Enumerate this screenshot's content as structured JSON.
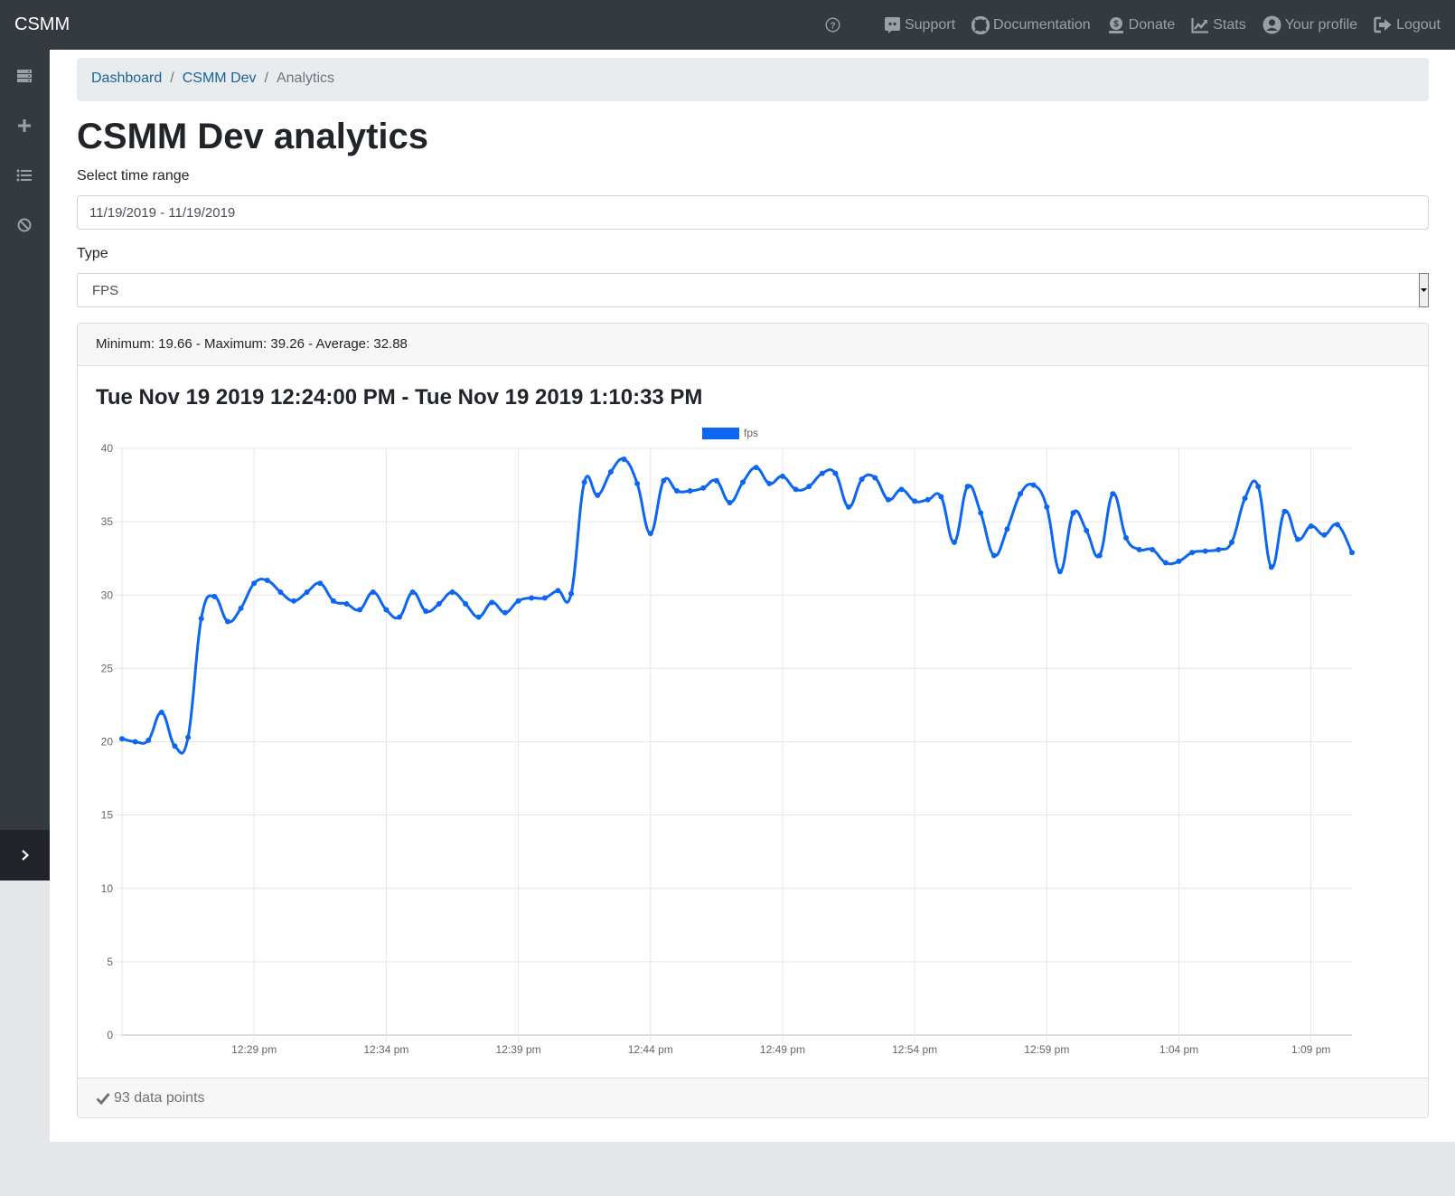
{
  "app": {
    "brand": "CSMM"
  },
  "nav": {
    "support": "Support",
    "documentation": "Documentation",
    "donate": "Donate",
    "stats": "Stats",
    "profile": "Your profile",
    "logout": "Logout"
  },
  "breadcrumb": {
    "dashboard": "Dashboard",
    "server": "CSMM Dev",
    "current": "Analytics"
  },
  "page": {
    "title": "CSMM Dev analytics",
    "time_range_label": "Select time range",
    "time_range_value": "11/19/2019 - 11/19/2019",
    "type_label": "Type",
    "type_value": "FPS"
  },
  "card": {
    "summary": "Minimum: 19.66 - Maximum: 39.26 - Average: 32.88",
    "title": "Tue Nov 19 2019 12:24:00 PM - Tue Nov 19 2019 1:10:33 PM",
    "footer": "93 data points"
  },
  "colors": {
    "line": "#0d66f0",
    "topbar": "#343a40",
    "link": "#1a6496"
  },
  "chart_data": {
    "type": "line",
    "title": "",
    "xlabel": "",
    "ylabel": "",
    "ylim": [
      0,
      40
    ],
    "y_ticks": [
      0,
      5,
      10,
      15,
      20,
      25,
      30,
      35,
      40
    ],
    "x_tick_labels": [
      "12:29 pm",
      "12:34 pm",
      "12:39 pm",
      "12:44 pm",
      "12:49 pm",
      "12:54 pm",
      "12:59 pm",
      "1:04 pm",
      "1:09 pm"
    ],
    "x_tick_minutes": [
      5,
      10,
      15,
      20,
      25,
      30,
      35,
      40,
      45
    ],
    "x_range_minutes": [
      0,
      46.55
    ],
    "grid": true,
    "legend": "top-center",
    "series": [
      {
        "name": "fps",
        "x_minutes": [
          0,
          0.5,
          1,
          1.5,
          2,
          2.5,
          3,
          3.5,
          4,
          4.5,
          5,
          5.5,
          6,
          6.5,
          7,
          7.5,
          8,
          8.5,
          9,
          9.5,
          10,
          10.5,
          11,
          11.5,
          12,
          12.5,
          13,
          13.5,
          14,
          14.5,
          15,
          15.5,
          16,
          16.5,
          17,
          17.5,
          18,
          18.5,
          19,
          19.5,
          20,
          20.5,
          21,
          21.5,
          22,
          22.5,
          23,
          23.5,
          24,
          24.5,
          25,
          25.5,
          26,
          26.5,
          27,
          27.5,
          28,
          28.5,
          29,
          29.5,
          30,
          30.5,
          31,
          31.5,
          32,
          32.5,
          33,
          33.5,
          34,
          34.5,
          35,
          35.5,
          36,
          36.5,
          37,
          37.5,
          38,
          38.5,
          39,
          39.5,
          40,
          40.5,
          41,
          41.5,
          42,
          42.5,
          43,
          43.5,
          44,
          44.5,
          45,
          45.5,
          46
        ],
        "values": [
          20.2,
          20.0,
          20.1,
          22.0,
          19.7,
          20.3,
          28.4,
          29.9,
          28.2,
          29.1,
          30.8,
          31.0,
          30.2,
          29.6,
          30.2,
          30.8,
          29.6,
          29.4,
          29.0,
          30.2,
          29.0,
          28.5,
          30.2,
          28.9,
          29.4,
          30.2,
          29.4,
          28.5,
          29.5,
          28.8,
          29.6,
          29.8,
          29.8,
          30.3,
          30.1,
          37.7,
          36.8,
          38.4,
          39.26,
          37.6,
          34.2,
          37.8,
          37.1,
          37.1,
          37.3,
          37.8,
          36.3,
          37.7,
          38.7,
          37.6,
          38.1,
          37.2,
          37.4,
          38.3,
          38.3,
          36.0,
          37.9,
          38.0,
          36.5,
          37.2,
          36.4,
          36.5,
          36.7,
          33.6,
          37.4,
          35.6,
          32.7,
          34.5,
          36.9,
          37.5,
          36.0,
          31.6,
          35.6,
          34.4,
          32.7,
          36.9,
          33.9,
          33.1,
          33.1,
          32.2,
          32.3,
          32.9,
          33.0,
          33.1,
          33.6,
          36.6,
          37.4,
          31.9,
          35.7,
          33.8,
          34.7,
          34.1,
          34.8
        ]
      }
    ],
    "last_point": {
      "x_minutes": 46.55,
      "value": 32.9
    }
  }
}
